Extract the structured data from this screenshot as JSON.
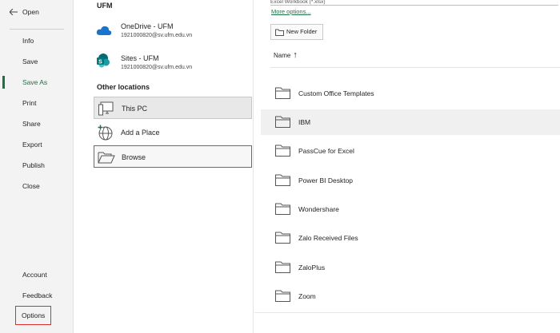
{
  "nav": {
    "items": [
      {
        "label": "Open"
      },
      {
        "label": "Info"
      },
      {
        "label": "Save"
      },
      {
        "label": "Save As"
      },
      {
        "label": "Print"
      },
      {
        "label": "Share"
      },
      {
        "label": "Export"
      },
      {
        "label": "Publish"
      },
      {
        "label": "Close"
      }
    ],
    "bottom": [
      {
        "label": "Account"
      },
      {
        "label": "Feedback"
      },
      {
        "label": "Options"
      }
    ]
  },
  "locations": {
    "section_ufm": "UFM",
    "accounts": [
      {
        "title": "OneDrive - UFM",
        "email": "1921000820@sv.ufm.edu.vn",
        "icon": "cloud-icon"
      },
      {
        "title": "Sites - UFM",
        "email": "1921000820@sv.ufm.edu.vn",
        "icon": "sharepoint-icon"
      }
    ],
    "section_other": "Other locations",
    "this_pc": "This PC",
    "add_place": "Add a Place",
    "browse": "Browse"
  },
  "files": {
    "filetype": "Excel Workbook (*.xlsx)",
    "more_options": "More options...",
    "new_folder": "New Folder",
    "name_col": "Name",
    "sort_arrow": "↑",
    "folders": [
      "Custom Office Templates",
      "IBM",
      "PassCue for Excel",
      "Power BI Desktop",
      "Wondershare",
      "Zalo Received Files",
      "ZaloPlus",
      "Zoom"
    ]
  },
  "colors": {
    "accent": "#1e7145",
    "highlight": "#d9302c",
    "onedrive": "#1a74c9",
    "sharepoint": "#0f7b6c"
  }
}
